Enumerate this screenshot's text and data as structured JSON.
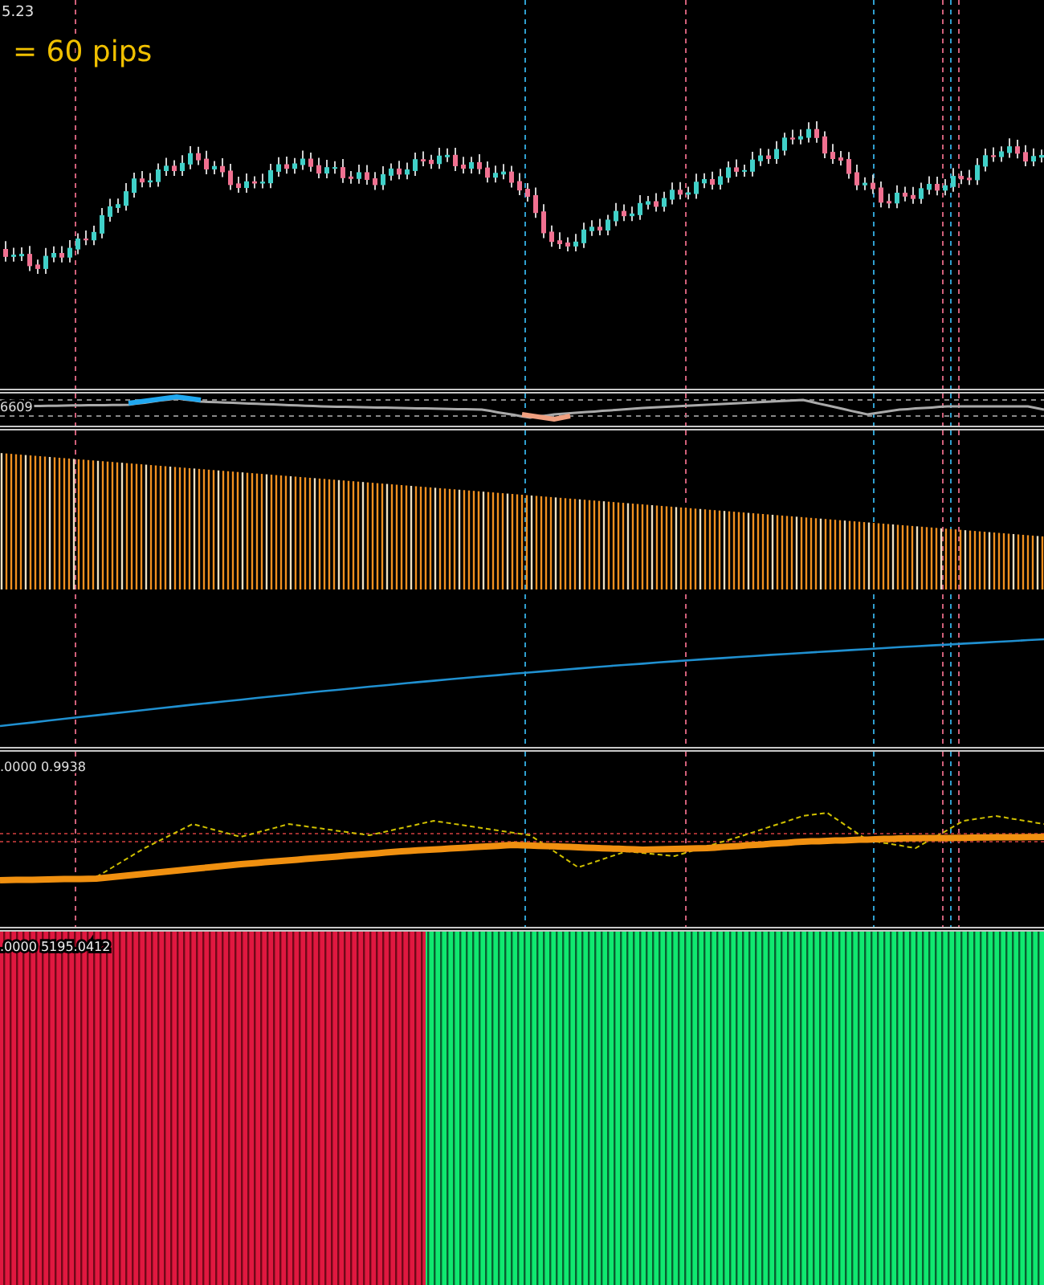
{
  "price_panel": {
    "price_label": "5.23",
    "pip_label": "= 60 pips"
  },
  "oscillator_panel": {
    "value_label": "6609"
  },
  "signal_panel": {
    "values_label": ".0000 0.9938"
  },
  "volume_panel": {
    "values_label": ".0000 5195.0412"
  }
}
